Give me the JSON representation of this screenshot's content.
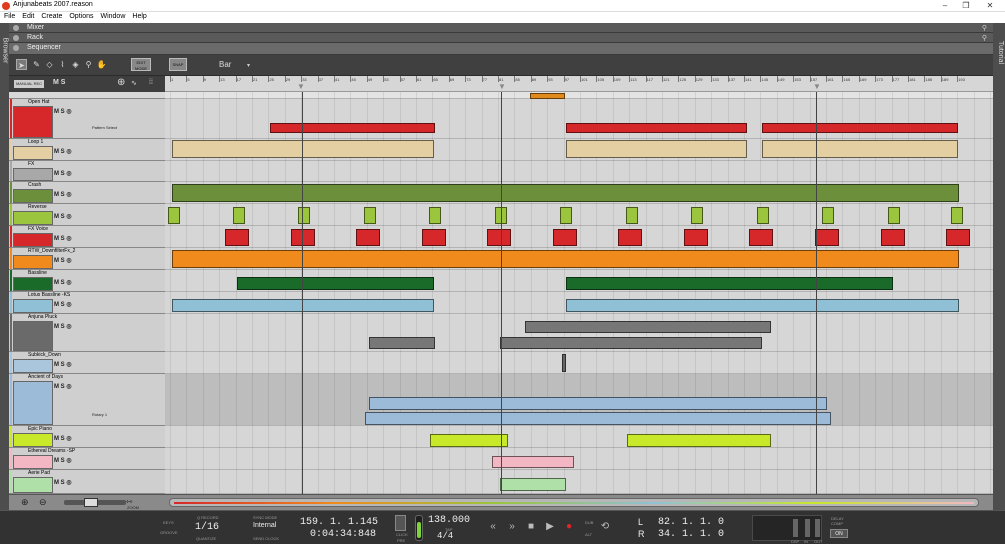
{
  "window": {
    "title": "Anjunabeats 2007.reason",
    "minimize": "–",
    "maximize": "❐",
    "close": "✕"
  },
  "menu": [
    "File",
    "Edit",
    "Create",
    "Options",
    "Window",
    "Help"
  ],
  "side": {
    "browser": "Browser",
    "tutorial": "Tutorial"
  },
  "sections": [
    {
      "name": "Mixer"
    },
    {
      "name": "Rack"
    },
    {
      "name": "Sequencer"
    }
  ],
  "toolbar": {
    "edit_mode": "EDIT MODE",
    "snap": "SNAP",
    "snap_value": "Bar",
    "manual_rec": "MANUAL REC",
    "ms": "M S"
  },
  "ruler": {
    "bars": [
      "1",
      "5",
      "9",
      "13",
      "17",
      "21",
      "25",
      "29",
      "33",
      "37",
      "41",
      "45",
      "49",
      "53",
      "57",
      "61",
      "65",
      "69",
      "73",
      "77",
      "81",
      "85",
      "89",
      "93",
      "97",
      "101",
      "105",
      "109",
      "113",
      "117",
      "121",
      "125",
      "129",
      "133",
      "137",
      "141",
      "145",
      "149",
      "153",
      "157",
      "161",
      "165",
      "169",
      "173",
      "177",
      "181",
      "185",
      "189",
      "193"
    ]
  },
  "tracks": [
    {
      "name": "Open Hat",
      "color": "#d6282a",
      "sub": "Pattern Select"
    },
    {
      "name": "Loop 1",
      "color": "#e3cfa1"
    },
    {
      "name": "FX",
      "color": "#a8a8a8"
    },
    {
      "name": "Crash",
      "color": "#6b8f3a"
    },
    {
      "name": "Reverse",
      "color": "#9bc53d"
    },
    {
      "name": "FX Voice",
      "color": "#d6282a"
    },
    {
      "name": "RTW_DownfilterFx_2",
      "color": "#f08a1c"
    },
    {
      "name": "Bassline",
      "color": "#1a6b2a"
    },
    {
      "name": "Lotus Bassline -KS",
      "color": "#8fc0d6"
    },
    {
      "name": "Anjuna Pluck",
      "color": "#6a6a6a"
    },
    {
      "name": "Subkick_Down",
      "color": "#a9c6dd"
    },
    {
      "name": "Ancient of Days",
      "color": "#9bbbd8",
      "sub": "Rotary 1"
    },
    {
      "name": "Epic Piano",
      "color": "#c8e82a"
    },
    {
      "name": "Ethereal Dreams -SP",
      "color": "#f2b7c2"
    },
    {
      "name": "Aerie Pad",
      "color": "#aee0a8"
    }
  ],
  "transport": {
    "quantize_label": "Q RECORD",
    "quantize": "1/16",
    "quantize_sub": "QUANTIZE",
    "groove_label": "GROOVE",
    "keys_label": "KEYS",
    "sync_label": "SYNC MODE",
    "sync": "Internal",
    "sync_sub": "SEND CLOCK",
    "position": "159.  1.  1.145",
    "time": "0:04:34:848",
    "click": "CLICK",
    "pre": "PRE",
    "tempo": "138.000",
    "tap": "TAP",
    "signature": "4/4",
    "dub": "DUB",
    "alt": "ALT",
    "loop_l": "82.  1.  1.    0",
    "loop_r": "34.  1.  1.    0",
    "l": "L",
    "r": "R",
    "delay_comp": "DELAY COMP",
    "on": "ON",
    "dsp": "DSP",
    "in": "IN",
    "out": "OUT",
    "zoom": "ZOOM"
  }
}
